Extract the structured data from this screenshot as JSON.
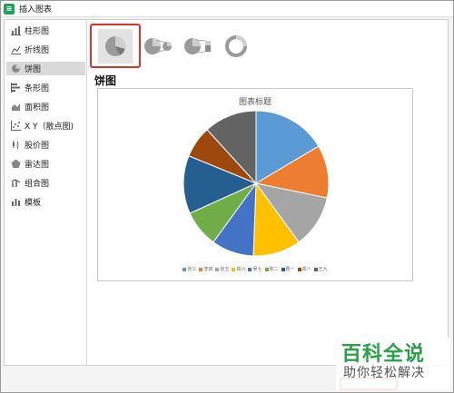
{
  "window": {
    "title": "插入图表"
  },
  "sidebar": {
    "items": [
      {
        "label": "柱形图",
        "icon": "column-chart-icon"
      },
      {
        "label": "折线图",
        "icon": "line-chart-icon"
      },
      {
        "label": "饼图",
        "icon": "pie-chart-icon",
        "active": true
      },
      {
        "label": "条形图",
        "icon": "bar-chart-icon"
      },
      {
        "label": "面积图",
        "icon": "area-chart-icon"
      },
      {
        "label": "X Y（散点图)",
        "icon": "scatter-chart-icon"
      },
      {
        "label": "股价图",
        "icon": "stock-chart-icon"
      },
      {
        "label": "雷达图",
        "icon": "radar-chart-icon"
      },
      {
        "label": "组合图",
        "icon": "combo-chart-icon"
      },
      {
        "label": "模板",
        "icon": "template-icon"
      }
    ]
  },
  "subtypes": [
    {
      "name": "pie",
      "selected": true
    },
    {
      "name": "pie-of-pie"
    },
    {
      "name": "bar-of-pie"
    },
    {
      "name": "doughnut"
    }
  ],
  "section": {
    "title": "饼图"
  },
  "chart_data": {
    "type": "pie",
    "title": "图表标题",
    "categories": [
      "张三",
      "李四",
      "赵五",
      "铁六",
      "吴七",
      "陈二",
      "曹一",
      "郑八",
      "王九"
    ],
    "values": [
      14,
      10,
      10,
      9,
      8,
      7,
      11,
      6,
      10
    ],
    "colors": [
      "#5b9bd5",
      "#ed7d31",
      "#a5a5a5",
      "#ffc000",
      "#4472c4",
      "#70ad47",
      "#255e91",
      "#9e480e",
      "#636363"
    ],
    "legend": "bottom"
  },
  "buttons": {
    "ok_label": ""
  },
  "watermark": {
    "title": "百科全说",
    "subtitle": "助你轻松解决"
  }
}
